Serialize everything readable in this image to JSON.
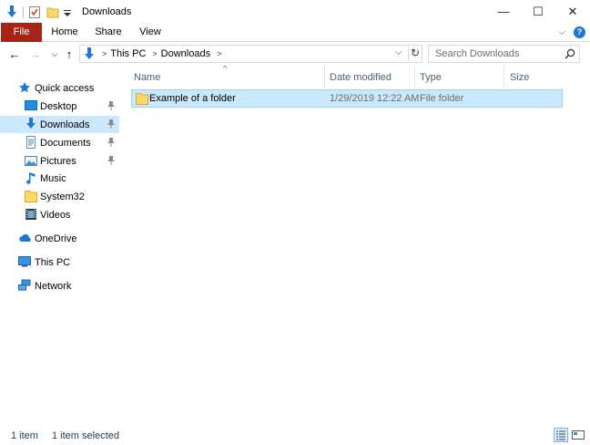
{
  "window": {
    "title": "Downloads",
    "minimize_glyph": "—",
    "maximize_glyph": "☐",
    "close_glyph": "✕"
  },
  "ribbon": {
    "tabs": [
      {
        "label": "File"
      },
      {
        "label": "Home"
      },
      {
        "label": "Share"
      },
      {
        "label": "View"
      }
    ],
    "expand_glyph": "⌵",
    "help_glyph": "?"
  },
  "address": {
    "crumbs": [
      "This PC",
      "Downloads"
    ],
    "dropdown_glyph": "⌵",
    "refresh_glyph": "↻"
  },
  "search": {
    "placeholder": "Search Downloads"
  },
  "nav": {
    "back_glyph": "←",
    "forward_glyph": "→",
    "recent_glyph": "⌵",
    "up_glyph": "↑",
    "items": [
      {
        "label": "Quick access",
        "icon": "star-icon"
      },
      {
        "label": "Desktop",
        "icon": "desktop-icon",
        "pinned": true
      },
      {
        "label": "Downloads",
        "icon": "download-icon",
        "pinned": true,
        "selected": true
      },
      {
        "label": "Documents",
        "icon": "documents-icon",
        "pinned": true
      },
      {
        "label": "Pictures",
        "icon": "pictures-icon",
        "pinned": true
      },
      {
        "label": "Music",
        "icon": "music-icon"
      },
      {
        "label": "System32",
        "icon": "folder-icon"
      },
      {
        "label": "Videos",
        "icon": "videos-icon"
      },
      {
        "label": "OneDrive",
        "icon": "onedrive-icon"
      },
      {
        "label": "This PC",
        "icon": "this-pc-icon"
      },
      {
        "label": "Network",
        "icon": "network-icon"
      }
    ]
  },
  "list": {
    "columns": [
      "Name",
      "Date modified",
      "Type",
      "Size"
    ],
    "sort_glyph": "^",
    "rows": [
      {
        "name": "Example of a folder",
        "date": "1/29/2019 12:22 AM",
        "type": "File folder",
        "size": ""
      }
    ]
  },
  "status": {
    "count": "1 item",
    "selected": "1 item selected"
  },
  "colors": {
    "file_tab": "#a62516",
    "selection": "#cce8ff",
    "selection_border": "#99d1ff",
    "header_text": "#4c607a",
    "accent_blue": "#1f78d1"
  }
}
